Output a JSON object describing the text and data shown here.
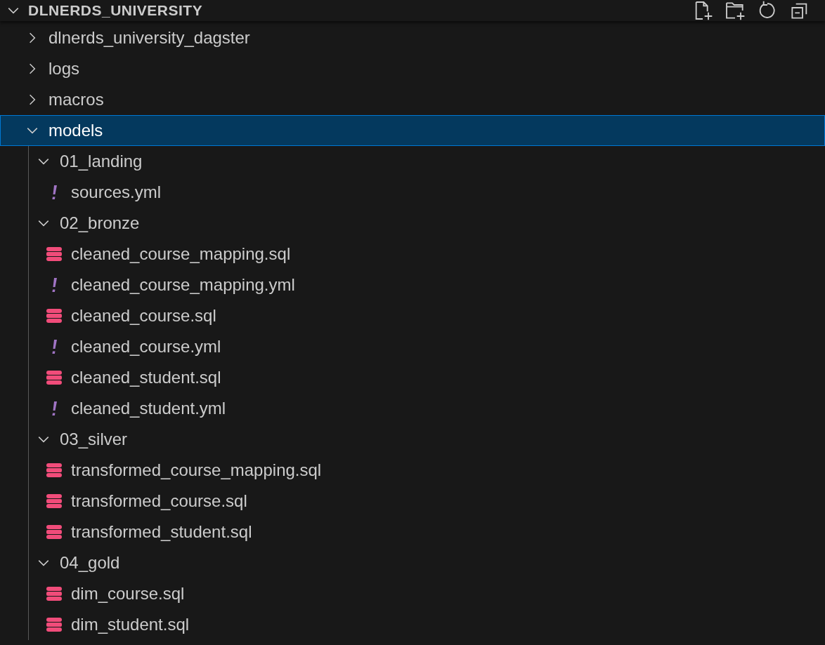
{
  "explorer": {
    "title": "DLNERDS_UNIVERSITY",
    "expanded": true
  },
  "tree": [
    {
      "kind": "folder",
      "name": "dlnerds_university_dagster",
      "expanded": false,
      "selected": false
    },
    {
      "kind": "folder",
      "name": "logs",
      "expanded": false,
      "selected": false
    },
    {
      "kind": "folder",
      "name": "macros",
      "expanded": false,
      "selected": false
    },
    {
      "kind": "folder",
      "name": "models",
      "expanded": true,
      "selected": true,
      "children": [
        {
          "kind": "folder",
          "name": "01_landing",
          "expanded": true,
          "selected": false,
          "children": [
            {
              "kind": "yaml",
              "name": "sources.yml",
              "selected": false
            }
          ]
        },
        {
          "kind": "folder",
          "name": "02_bronze",
          "expanded": true,
          "selected": false,
          "children": [
            {
              "kind": "sql",
              "name": "cleaned_course_mapping.sql",
              "selected": false
            },
            {
              "kind": "yaml",
              "name": "cleaned_course_mapping.yml",
              "selected": false
            },
            {
              "kind": "sql",
              "name": "cleaned_course.sql",
              "selected": false
            },
            {
              "kind": "yaml",
              "name": "cleaned_course.yml",
              "selected": false
            },
            {
              "kind": "sql",
              "name": "cleaned_student.sql",
              "selected": false
            },
            {
              "kind": "yaml",
              "name": "cleaned_student.yml",
              "selected": false
            }
          ]
        },
        {
          "kind": "folder",
          "name": "03_silver",
          "expanded": true,
          "selected": false,
          "children": [
            {
              "kind": "sql",
              "name": "transformed_course_mapping.sql",
              "selected": false
            },
            {
              "kind": "sql",
              "name": "transformed_course.sql",
              "selected": false
            },
            {
              "kind": "sql",
              "name": "transformed_student.sql",
              "selected": false
            }
          ]
        },
        {
          "kind": "folder",
          "name": "04_gold",
          "expanded": true,
          "selected": false,
          "children": [
            {
              "kind": "sql",
              "name": "dim_course.sql",
              "selected": false
            },
            {
              "kind": "sql",
              "name": "dim_student.sql",
              "selected": false
            }
          ]
        }
      ]
    }
  ]
}
